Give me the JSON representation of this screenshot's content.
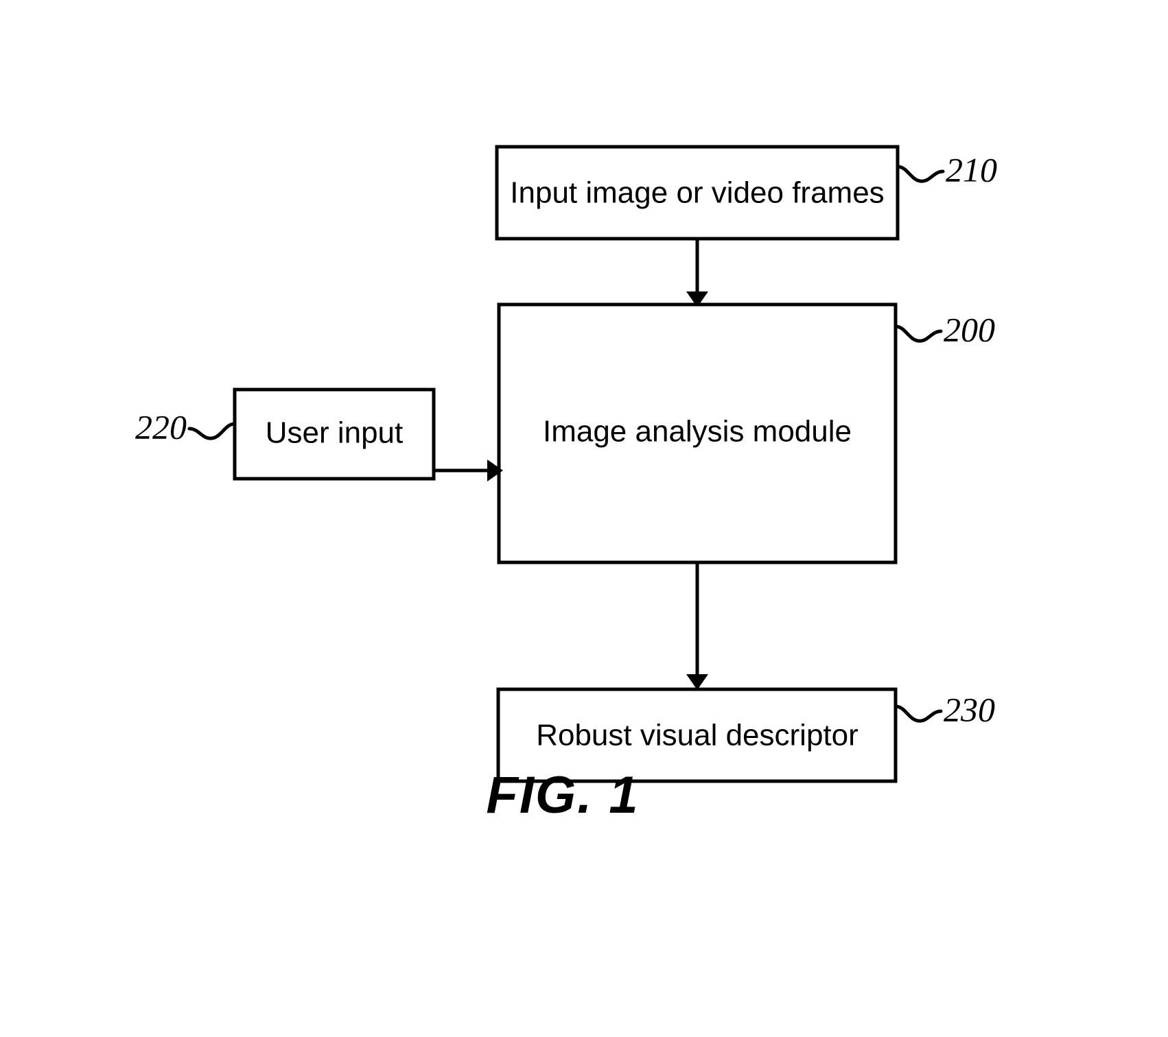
{
  "figure": {
    "caption": "FIG. 1",
    "stroke_color": "#000000",
    "fill_color": "#ffffff"
  },
  "blocks": [
    {
      "id": "input-image-or-video-frames",
      "label": "Input image or video frames",
      "ref": "210"
    },
    {
      "id": "image-analysis-module",
      "label": "Image analysis module",
      "ref": "200"
    },
    {
      "id": "user-input",
      "label": "User input",
      "ref": "220"
    },
    {
      "id": "robust-visual-descriptor",
      "label": "Robust visual descriptor",
      "ref": "230"
    }
  ],
  "connections": [
    {
      "id": "input-to-module",
      "from": "input-image-or-video-frames",
      "to": "image-analysis-module",
      "direction": "down"
    },
    {
      "id": "user-input-to-module",
      "from": "user-input",
      "to": "image-analysis-module",
      "direction": "right"
    },
    {
      "id": "module-to-descriptor",
      "from": "image-analysis-module",
      "to": "robust-visual-descriptor",
      "direction": "down"
    }
  ]
}
